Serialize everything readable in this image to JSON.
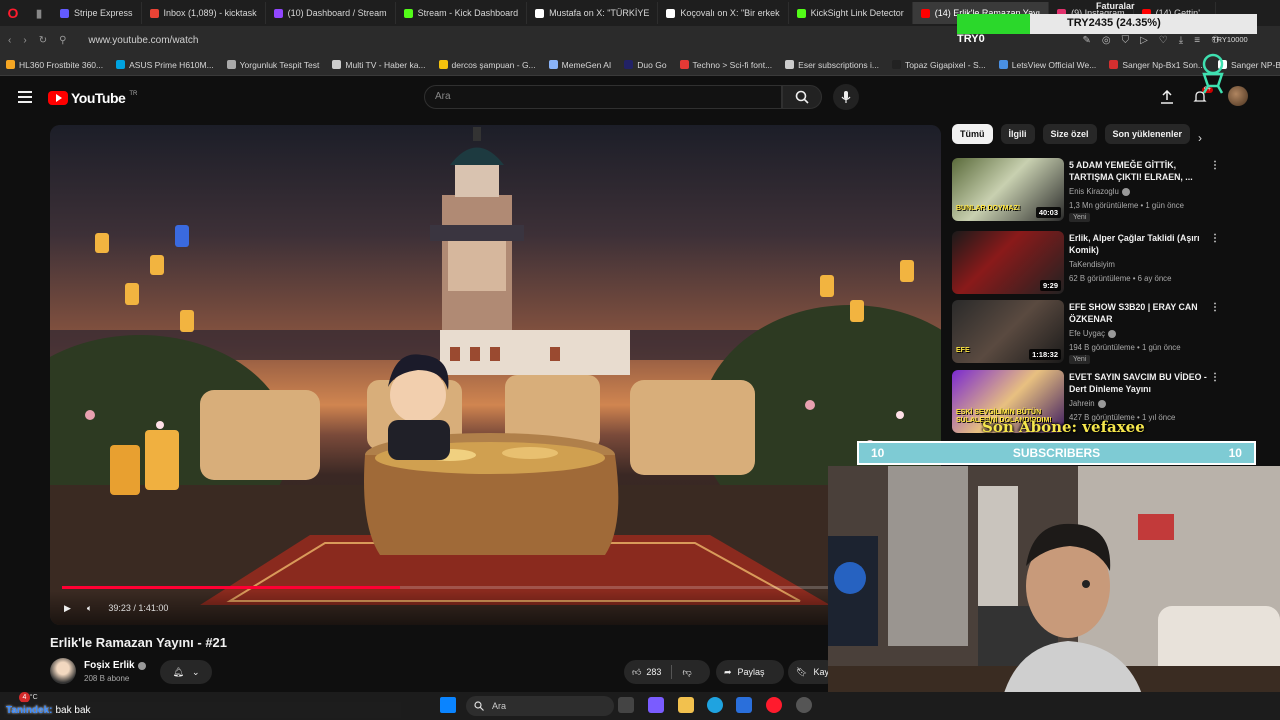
{
  "browser": {
    "tabs": [
      {
        "label": "Stripe Express",
        "color": "#635bff"
      },
      {
        "label": "Inbox (1,089) - kicktask",
        "color": "#ea4335"
      },
      {
        "label": "(10) Dashboard / Stream",
        "color": "#9146ff"
      },
      {
        "label": "Stream - Kick Dashboard",
        "color": "#53fc18"
      },
      {
        "label": "Mustafa on X: \"TÜRKİYE",
        "color": "#ffffff"
      },
      {
        "label": "Koçovalı on X: \"Bir erkek",
        "color": "#ffffff"
      },
      {
        "label": "KickSight Link Detector",
        "color": "#53fc18"
      },
      {
        "label": "(14) Erlik'le Ramazan Yayı",
        "color": "#ff0000"
      },
      {
        "label": "(9) Instagram",
        "color": "#e1306c"
      },
      {
        "label": "(14) Gettin'...",
        "color": "#ff0000"
      }
    ],
    "url": "www.youtube.com/watch",
    "bookmarks": [
      {
        "label": "HL360 Frostbite 360...",
        "color": "#f5a623"
      },
      {
        "label": "ASUS Prime H610M...",
        "color": "#00a3e0"
      },
      {
        "label": "Yorgunluk Tespit Test",
        "color": "#aaaaaa"
      },
      {
        "label": "Multi TV - Haber ka...",
        "color": "#cccccc"
      },
      {
        "label": "dercos şampuan - G...",
        "color": "#f4c20d"
      },
      {
        "label": "MemeGen AI",
        "color": "#8ab4f8"
      },
      {
        "label": "Duo Go",
        "color": "#222266"
      },
      {
        "label": "Techno > Sci-fi font...",
        "color": "#e53935"
      },
      {
        "label": "Eser subscriptions i...",
        "color": "#cccccc"
      },
      {
        "label": "Topaz Gigapixel - S...",
        "color": "#222222"
      },
      {
        "label": "LetsView Official We...",
        "color": "#4a90e2"
      },
      {
        "label": "Sanger Np-Bx1 Son...",
        "color": "#d32f2f"
      },
      {
        "label": "Sanger NP-BX1 S",
        "color": "#ffffff"
      }
    ]
  },
  "youtube": {
    "logo": "YouTube",
    "region": "TR",
    "search_placeholder": "Ara",
    "notification_count": "9+",
    "video": {
      "time": "39:23 / 1:41:00",
      "progress": 0.39,
      "title": "Erlik'le Ramazan Yayını - #21",
      "channel": "Foşix Erlik",
      "subscribers": "208 B abone",
      "likes": "283",
      "share_label": "Paylaş",
      "save_label": "Kay"
    },
    "chips": [
      "Tümü",
      "İlgili",
      "Size özel",
      "Son yüklenenler"
    ],
    "recommendations": [
      {
        "title": "5 ADAM YEMEĞE GİTTİK, TARTIŞMA ÇIKTI! ELRAEN, ...",
        "channel": "Enis Kirazoglu",
        "meta": "1,3 Mn görüntüleme • 1 gün önce",
        "badge": "Yeni",
        "duration": "40:03",
        "thumb_text": "BUNLAR DOYMAZ!"
      },
      {
        "title": "Erlik, Alper Çağlar Taklidi (Aşırı Komik)",
        "channel": "TaKendisiyim",
        "meta": "62 B görüntüleme • 6 ay önce",
        "badge": "",
        "duration": "9:29",
        "thumb_text": ""
      },
      {
        "title": "EFE SHOW S3B20 | ERAY CAN ÖZKENAR",
        "channel": "Efe Uygaç",
        "meta": "194 B görüntüleme • 1 gün önce",
        "badge": "Yeni",
        "duration": "1:18:32",
        "thumb_text": "EFE"
      },
      {
        "title": "EVET SAYIN SAVCIM BU VİDEO - Dert Dinleme Yayını",
        "channel": "Jahrein",
        "meta": "427 B görüntüleme • 1 yıl önce",
        "badge": "",
        "duration": "",
        "thumb_text": "ESKİ SEVGİLİMİN BÜTÜN SÜLALESİNİ DOLANDIRDIM!"
      }
    ]
  },
  "overlay": {
    "xp_text": "TRY2435 (24.35%)",
    "xp_fraction": 0.2435,
    "xp_label": "TRY0",
    "xp_right": "TRY10000",
    "faturalar": "Faturalar",
    "son_abone": "Son Abone: vefaxee",
    "subs_left": "10",
    "subs_label": "SUBSCRIBERS",
    "subs_right": "10"
  },
  "taskbar": {
    "weather": "10°C",
    "notif": "4",
    "search_label": "Ara",
    "chat_user": "Tanindek:",
    "chat_message": "bak bak"
  }
}
